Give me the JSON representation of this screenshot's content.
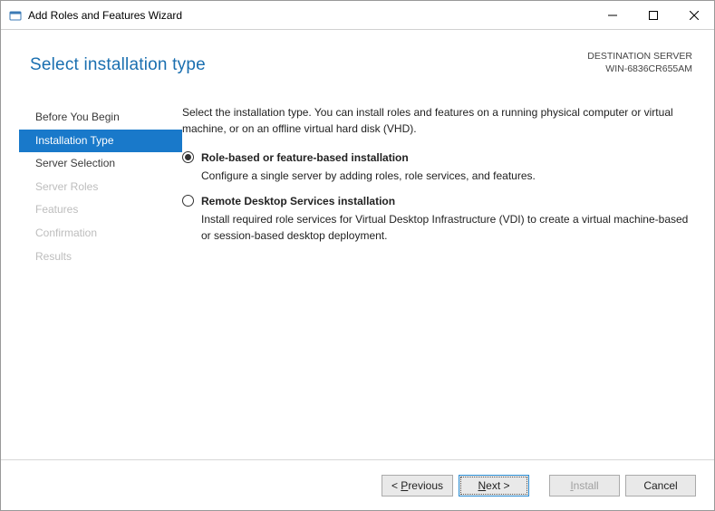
{
  "window": {
    "title": "Add Roles and Features Wizard"
  },
  "header": {
    "heading": "Select installation type",
    "destination_label": "DESTINATION SERVER",
    "destination_value": "WIN-6836CR655AM"
  },
  "sidebar": {
    "items": [
      {
        "label": "Before You Begin",
        "state": "enabled"
      },
      {
        "label": "Installation Type",
        "state": "active"
      },
      {
        "label": "Server Selection",
        "state": "enabled"
      },
      {
        "label": "Server Roles",
        "state": "disabled"
      },
      {
        "label": "Features",
        "state": "disabled"
      },
      {
        "label": "Confirmation",
        "state": "disabled"
      },
      {
        "label": "Results",
        "state": "disabled"
      }
    ]
  },
  "main": {
    "intro": "Select the installation type. You can install roles and features on a running physical computer or virtual machine, or on an offline virtual hard disk (VHD).",
    "options": [
      {
        "label": "Role-based or feature-based installation",
        "desc": "Configure a single server by adding roles, role services, and features.",
        "selected": true
      },
      {
        "label": "Remote Desktop Services installation",
        "desc": "Install required role services for Virtual Desktop Infrastructure (VDI) to create a virtual machine-based or session-based desktop deployment.",
        "selected": false
      }
    ]
  },
  "footer": {
    "previous_prefix": "< ",
    "previous_ul": "P",
    "previous_rest": "revious",
    "next_ul": "N",
    "next_rest": "ext >",
    "install_ul": "I",
    "install_rest": "nstall",
    "cancel": "Cancel"
  }
}
